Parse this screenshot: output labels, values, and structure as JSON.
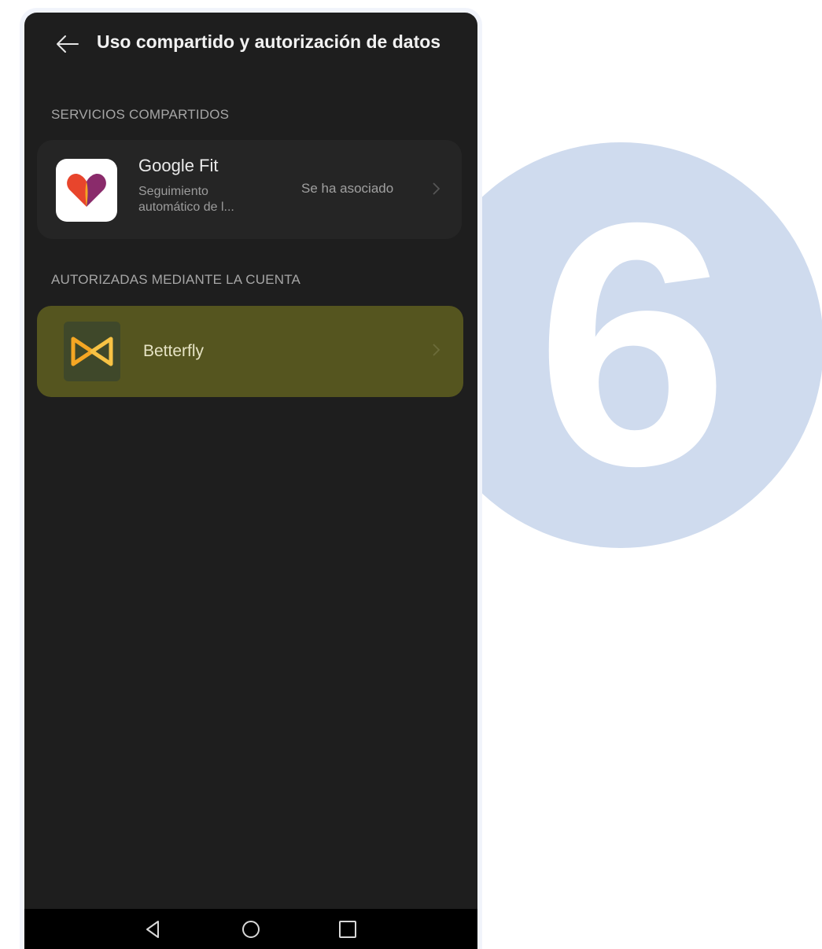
{
  "step": {
    "number": "6"
  },
  "header": {
    "title": "Uso compartido y autorización de datos"
  },
  "sections": {
    "shared": {
      "label": "SERVICIOS COMPARTIDOS",
      "item": {
        "name": "Google Fit",
        "description_line1": "Seguimiento",
        "description_line2": "automático de l...",
        "status": "Se ha asociado",
        "icon": "google-fit-heart-icon"
      }
    },
    "authorized": {
      "label": "AUTORIZADAS MEDIANTE LA CUENTA",
      "item": {
        "name": "Betterfly",
        "icon": "betterfly-logo-icon",
        "highlight_color": "#55551f"
      }
    }
  },
  "navbar": {
    "icons": [
      "back-triangle-icon",
      "home-circle-icon",
      "recents-square-icon"
    ]
  },
  "colors": {
    "background": "#1e1e1e",
    "step_circle": "#cfdbee",
    "highlight": "#55551f"
  }
}
